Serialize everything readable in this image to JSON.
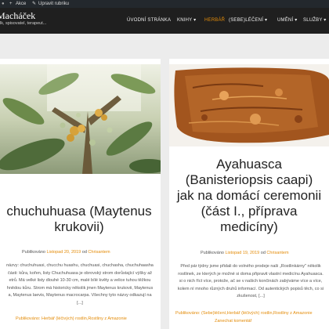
{
  "adminbar": {
    "item1": "Akce",
    "item2": "Upravit rubriku"
  },
  "site": {
    "title": "Macháček",
    "tagline": "lk, spisovatel, terapeut..."
  },
  "nav": [
    {
      "label": "ÚVODNÍ STRÁNKA"
    },
    {
      "label": "KNIHY ▾"
    },
    {
      "label": "HERBÁŘ"
    },
    {
      "label": "(SEBE)LÉČENÍ ▾"
    },
    {
      "label": "UMĚNÍ ▾"
    },
    {
      "label": "SLUŽBY ▾"
    }
  ],
  "posts": [
    {
      "title_line1": "chuchuhuasa (Maytenus",
      "title_line2": "krukovii)",
      "published_label": "Publikováno",
      "date": "Listopad 20, 2019",
      "by": "od",
      "author": "Chrisantem",
      "excerpt": [
        "názvy: chuchuhuasi, chucchu huashu, chuchuasi, chuchasha, chuchuhaasha",
        "části: kůra, kořen, listy Chuchuhuasa je obrovský strom dorůstající výšky až",
        "etrů. Má velké listy dlouhé 10-30 cm, malé bílé květy a velice tuhou těžkou",
        "hnědou kůru. Strom má historicky několik jmen Maytenus krukovii, Maytenus",
        "a, Maytenus laevis, Maytenus macrocarpa. Všechny tyto názvy odkazují na",
        "[...]"
      ],
      "cats_line1": "Publikováno: Herbář (léčivých) rostlin,Rostliny z Amazonie"
    },
    {
      "title_line1": "Ayahuasca",
      "title_line2": "(Banisteriopsis caapi)",
      "title_line3": "jak na domácí ceremonii",
      "title_line4": "(část I., příprava",
      "title_line5": "medicíny)",
      "published_label": "Publikováno",
      "date": "Listopad 19, 2019",
      "by": "od",
      "author": "Chrisantem",
      "excerpt": [
        "Před pár týdny jsme přidali do volného prodeje naši „Rostlinkárny\" několik",
        "rostlinek, ze kterých je možné si doma připravit vlastní medicínu Ayahuasca.",
        "si o nich říct více, protože, ač se v našich končinách zabýváme více a více,",
        "kolem ní mnoho různých druhů informací. Od autentických popisů těch, co si",
        "zkušenost, [...]"
      ],
      "cats_line1": "Publikováno: (Sebe)léčení,Herbář (léčivých) rostlin,Rostliny z Amazonie",
      "cats_line2": "Zanechat komentář"
    }
  ]
}
